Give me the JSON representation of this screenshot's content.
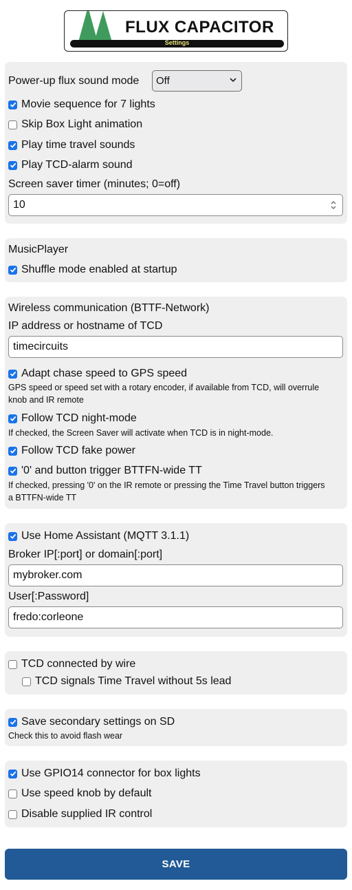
{
  "logo": {
    "title": "FLUX CAPACITOR",
    "subtitle": "Settings"
  },
  "general": {
    "sound_mode_label": "Power-up flux sound mode",
    "sound_mode_value": "Off",
    "movie_sequence": {
      "label": "Movie sequence for 7 lights",
      "checked": true
    },
    "skip_box_light": {
      "label": "Skip Box Light animation",
      "checked": false
    },
    "play_tt_sounds": {
      "label": "Play time travel sounds",
      "checked": true
    },
    "play_alarm": {
      "label": "Play TCD-alarm sound",
      "checked": true
    },
    "screensaver_label": "Screen saver timer (minutes; 0=off)",
    "screensaver_value": "10"
  },
  "music": {
    "heading": "MusicPlayer",
    "shuffle": {
      "label": "Shuffle mode enabled at startup",
      "checked": true
    }
  },
  "wireless": {
    "heading": "Wireless communication (BTTF-Network)",
    "tcd_ip_label": "IP address or hostname of TCD",
    "tcd_ip_value": "timecircuits",
    "adapt_chase": {
      "label": "Adapt chase speed to GPS speed",
      "checked": true
    },
    "adapt_chase_hint": "GPS speed or speed set with a rotary encoder, if available from TCD, will overrule knob and IR remote",
    "follow_night": {
      "label": "Follow TCD night-mode",
      "checked": true
    },
    "follow_night_hint": "If checked, the Screen Saver will activate when TCD is in night-mode.",
    "follow_fake_power": {
      "label": "Follow TCD fake power",
      "checked": true
    },
    "zero_trigger": {
      "label": "'0' and button trigger BTTFN-wide TT",
      "checked": true
    },
    "zero_trigger_hint": "If checked, pressing '0' on the IR remote or pressing the Time Travel button triggers a BTTFN-wide TT"
  },
  "mqtt": {
    "use_ha": {
      "label": "Use Home Assistant (MQTT 3.1.1)",
      "checked": true
    },
    "broker_label": "Broker IP[:port] or domain[:port]",
    "broker_value": "mybroker.com",
    "user_label": "User[:Password]",
    "user_value": "fredo:corleone"
  },
  "wire": {
    "connected": {
      "label": "TCD connected by wire",
      "checked": false
    },
    "no_lead": {
      "label": "TCD signals Time Travel without 5s lead",
      "checked": false
    }
  },
  "sd": {
    "save_secondary": {
      "label": "Save secondary settings on SD",
      "checked": true
    },
    "hint": "Check this to avoid flash wear"
  },
  "hardware": {
    "gpio14": {
      "label": "Use GPIO14 connector for box lights",
      "checked": true
    },
    "speed_knob": {
      "label": "Use speed knob by default",
      "checked": false
    },
    "disable_ir": {
      "label": "Disable supplied IR control",
      "checked": false
    }
  },
  "save_button": {
    "label": "SAVE"
  },
  "colors": {
    "accent": "#1a73e8",
    "save_bg": "#215a96",
    "panel_bg": "#efefef",
    "tree_green": "#3f9b5d"
  }
}
